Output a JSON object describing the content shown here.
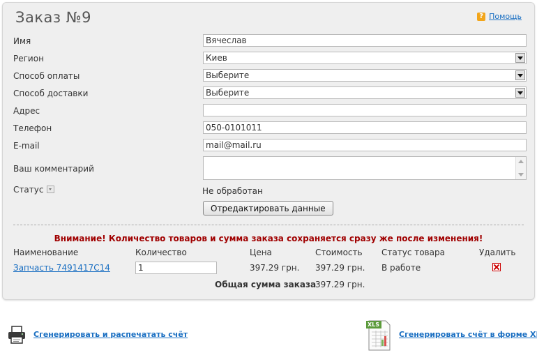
{
  "order": {
    "title": "Заказ №9",
    "help_label": "Помощь",
    "help_icon_glyph": "?"
  },
  "form": {
    "name_label": "Имя",
    "name_value": "Вячеслав",
    "region_label": "Регион",
    "region_value": "Киев",
    "payment_label": "Способ оплаты",
    "payment_value": "Выберите",
    "delivery_label": "Способ доставки",
    "delivery_value": "Выберите",
    "address_label": "Адрес",
    "address_value": "",
    "phone_label": "Телефон",
    "phone_value": "050-0101011",
    "email_label": "E-mail",
    "email_value": "mail@mail.ru",
    "comment_label": "Ваш комментарий",
    "comment_value": "",
    "status_label": "Статус",
    "status_value": "Не обработан",
    "edit_button": "Отредактировать данные"
  },
  "items": {
    "warning": "Внимание! Количество товаров и сумма заказа сохраняется сразу же после изменения!",
    "columns": {
      "name": "Наименование",
      "quantity": "Количество",
      "price": "Цена",
      "cost": "Стоимость",
      "status": "Статус товара",
      "delete": "Удалить"
    },
    "rows": [
      {
        "name": "Запчасть 7491417С14",
        "quantity": "1",
        "price": "397.29 грн.",
        "cost": "397.29 грн.",
        "status": "В работе"
      }
    ],
    "total_label": "Общая сумма заказа",
    "total_value": "397.29 грн."
  },
  "actions": {
    "print_invoice": "Сгенерировать и распечатать счёт",
    "xls_invoice": "Сгенерировать счёт в форме XLS",
    "xls_badge": "XLS"
  },
  "colors": {
    "link": "#1a6fc2",
    "warning": "#a00000",
    "panel": "#efefef"
  }
}
